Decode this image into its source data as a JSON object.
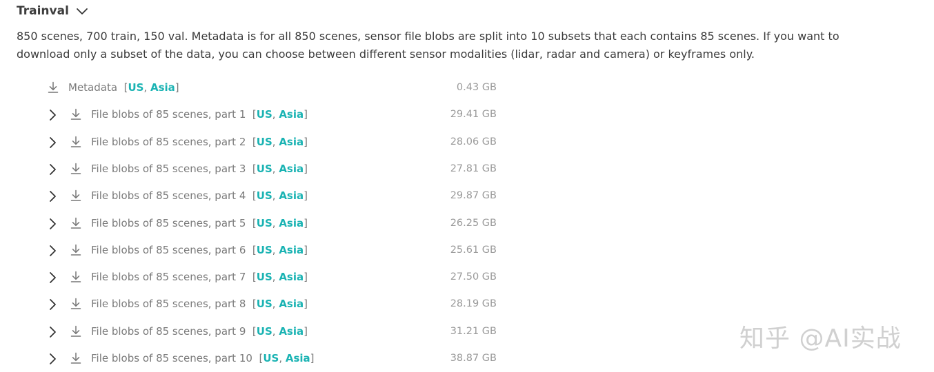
{
  "section": {
    "title": "Trainval",
    "description": "850 scenes, 700 train, 150 val. Metadata is for all 850 scenes, sensor file blobs are split into 10 subsets that each contains 85 scenes. If you want to download only a subset of the data, you can choose between different sensor modalities (lidar, radar and camera) or keyframes only."
  },
  "files": [
    {
      "label": "Metadata",
      "region1": "US",
      "region2": "Asia",
      "size": "0.43 GB",
      "expandable": false
    },
    {
      "label": "File blobs of 85 scenes, part 1",
      "region1": "US",
      "region2": "Asia",
      "size": "29.41 GB",
      "expandable": true
    },
    {
      "label": "File blobs of 85 scenes, part 2",
      "region1": "US",
      "region2": "Asia",
      "size": "28.06 GB",
      "expandable": true
    },
    {
      "label": "File blobs of 85 scenes, part 3",
      "region1": "US",
      "region2": "Asia",
      "size": "27.81 GB",
      "expandable": true
    },
    {
      "label": "File blobs of 85 scenes, part 4",
      "region1": "US",
      "region2": "Asia",
      "size": "29.87 GB",
      "expandable": true
    },
    {
      "label": "File blobs of 85 scenes, part 5",
      "region1": "US",
      "region2": "Asia",
      "size": "26.25 GB",
      "expandable": true
    },
    {
      "label": "File blobs of 85 scenes, part 6",
      "region1": "US",
      "region2": "Asia",
      "size": "25.61 GB",
      "expandable": true
    },
    {
      "label": "File blobs of 85 scenes, part 7",
      "region1": "US",
      "region2": "Asia",
      "size": "27.50 GB",
      "expandable": true
    },
    {
      "label": "File blobs of 85 scenes, part 8",
      "region1": "US",
      "region2": "Asia",
      "size": "28.19 GB",
      "expandable": true
    },
    {
      "label": "File blobs of 85 scenes, part 9",
      "region1": "US",
      "region2": "Asia",
      "size": "31.21 GB",
      "expandable": true
    },
    {
      "label": "File blobs of 85 scenes, part 10",
      "region1": "US",
      "region2": "Asia",
      "size": "38.87 GB",
      "expandable": true
    }
  ],
  "watermark": "知乎 @AI实战",
  "colors": {
    "region_link": "#1ab3b3",
    "label_text": "#7a7a7a",
    "size_text": "#9a9a9a"
  },
  "icons": {
    "collapse": "chevron-down-icon",
    "expand": "chevron-right-icon",
    "download": "download-icon"
  }
}
